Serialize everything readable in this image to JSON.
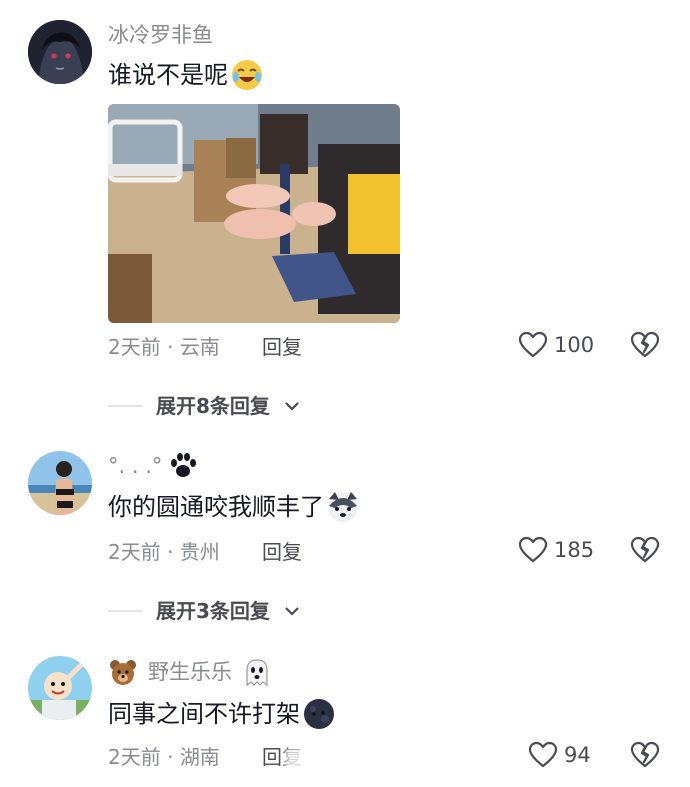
{
  "comments": [
    {
      "username": "冰冷罗非鱼",
      "text": "谁说不是呢",
      "emoji_icon": "laughing-crying-emoji-icon",
      "time": "2天前",
      "location": "云南",
      "reply_label": "回复",
      "likes": "100",
      "expand_label": "展开8条回复"
    },
    {
      "username": "°. . .°",
      "username_icon": "paw-icon",
      "text": "你的圆通咬我顺丰了",
      "emoji_icon": "husky-dog-emoji-icon",
      "time": "2天前",
      "location": "贵州",
      "reply_label": "回复",
      "likes": "185",
      "expand_label": "展开3条回复"
    },
    {
      "username_prefix_icon": "bear-icon",
      "username": "野生乐乐",
      "username_icon": "ghost-icon",
      "text": "同事之间不许打架",
      "emoji_icon": "dark-moon-emoji-icon",
      "time": "2天前",
      "location": "湖南",
      "reply_label": "回复",
      "likes": "94"
    }
  ],
  "separator": " · ",
  "colors": {
    "secondary_text": "#8a8b91",
    "primary_text": "#161823",
    "action_text": "#4a4b52"
  }
}
